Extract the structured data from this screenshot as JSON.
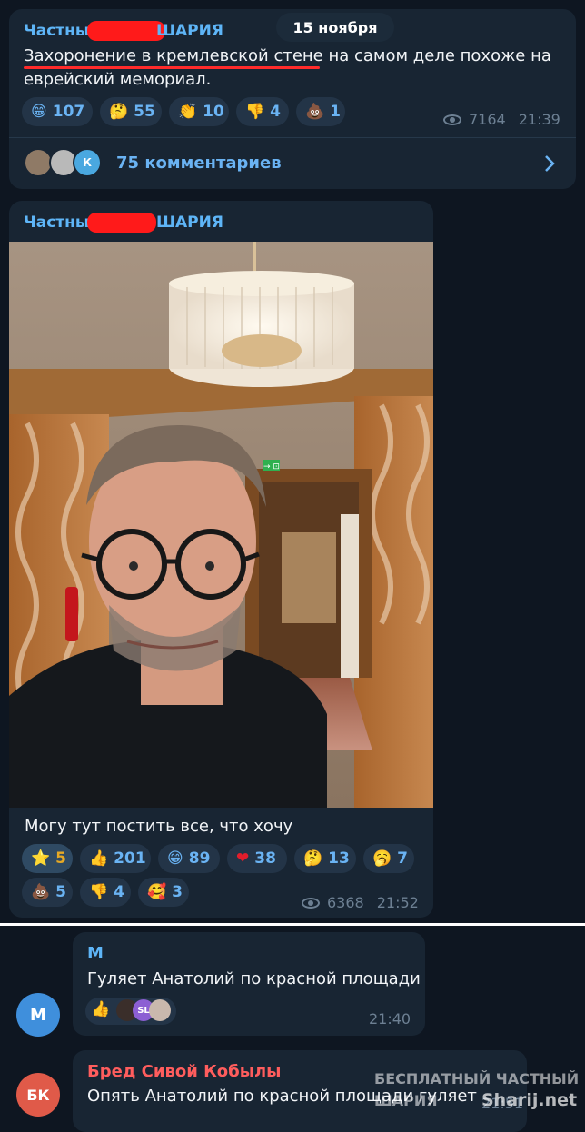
{
  "post1": {
    "channel_name": "Частный ШАРИЯ",
    "channel_left": "Частны",
    "channel_right": "ШАРИЯ",
    "date_pill": "15 ноября",
    "text_line1_start": "Захоронение в кремлевской стене",
    "text_line1_end": " на самом деле похоже на",
    "text_line2": "еврейский мемориал.",
    "reactions": [
      {
        "emoji": "😁",
        "count": "107"
      },
      {
        "emoji": "🤔",
        "count": "55"
      },
      {
        "emoji": "👏",
        "count": "10"
      },
      {
        "emoji": "👎",
        "count": "4"
      },
      {
        "emoji": "💩",
        "count": "1"
      }
    ],
    "views": "7164",
    "time": "21:39",
    "comments_label": "75 комментариев",
    "comment_avatar_letter": "К"
  },
  "post2": {
    "channel_left": "Частны",
    "channel_right": "ШАРИЯ",
    "caption": "Могу тут постить все, что хочу",
    "reactions": [
      {
        "emoji": "⭐",
        "count": "5"
      },
      {
        "emoji": "👍",
        "count": "201"
      },
      {
        "emoji": "😁",
        "count": "89"
      },
      {
        "emoji": "❤",
        "count": "38"
      },
      {
        "emoji": "🤔",
        "count": "13"
      },
      {
        "emoji": "🥱",
        "count": "7"
      },
      {
        "emoji": "💩",
        "count": "5"
      },
      {
        "emoji": "👎",
        "count": "4"
      },
      {
        "emoji": "🥰",
        "count": "3"
      }
    ],
    "views": "6368",
    "time": "21:52",
    "exit_sign": "→ ⊡"
  },
  "comment1": {
    "author": "М",
    "avatar_letter": "М",
    "text": "Гуляет Анатолий по красной площади",
    "reaction_emoji": "👍",
    "reactor_sl": "SL",
    "time": "21:40"
  },
  "comment2": {
    "author": "Бред Сивой Кобылы",
    "avatar_letter": "БК",
    "text": "Опять Анатолий по красной площади гуляет",
    "time": "21:51"
  },
  "watermark": {
    "line1": "БЕСПЛАТНЫЙ ЧАСТНЫЙ",
    "line2": "ШАРИЯ",
    "site": "Sharij.net"
  },
  "colors": {
    "background": "#0e1621",
    "bubble": "#182533",
    "accent": "#5eb5f7",
    "reaction_count": "#6ab3f3",
    "meta": "#6d8093",
    "redact": "#ff1a1a",
    "author_red": "#ff5d5d"
  }
}
